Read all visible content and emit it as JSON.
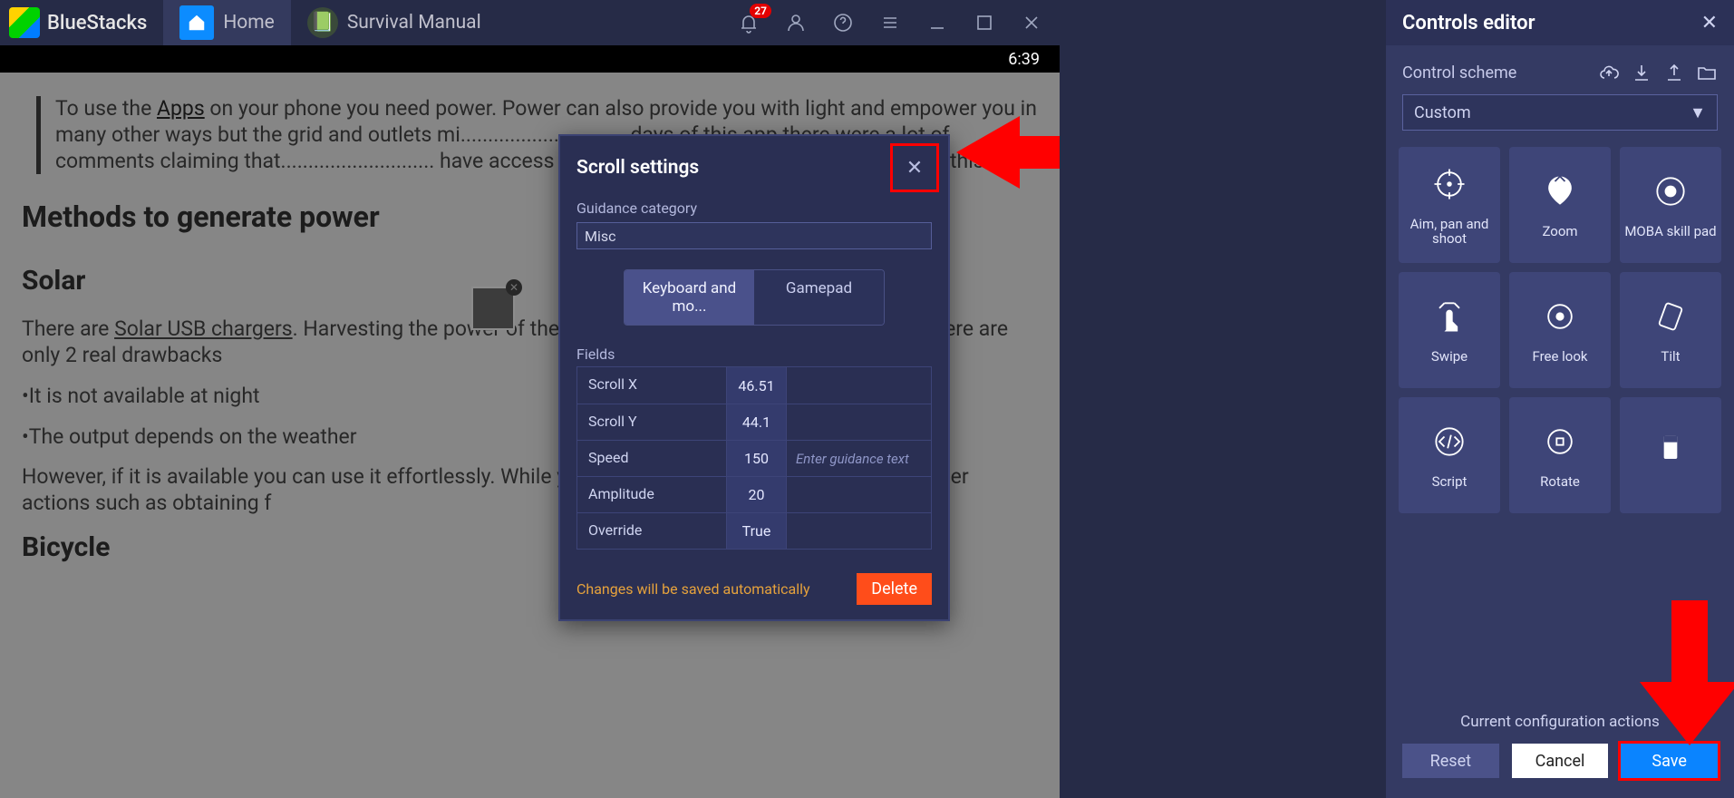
{
  "titlebar": {
    "brand": "BlueStacks",
    "tabs": [
      {
        "label": "Home"
      },
      {
        "label": "Survival Manual"
      }
    ],
    "badge": "27"
  },
  "statusbar": {
    "time": "6:39"
  },
  "content": {
    "intro_pre": "To use the ",
    "intro_link": "Apps",
    "intro_post": " on your phone you need power. Power can also provide you with light and empower you in many other ways but the grid and outlets mi.............................. days of this app there were a lot of comments claiming that............................ have access to grid power. I disagree and have created this",
    "h1": "Methods to generate power",
    "h2a": "Solar",
    "p_solar_pre": "There are ",
    "p_solar_link": "Solar USB chargers",
    "p_solar_post": ". Harvesting the power of the sur......... clean way to generate power. There are only 2 real drawbacks",
    "bullet1": "•It is not available at night",
    "bullet2": "•The output depends on the weather",
    "p_however": "However, if it is available you can use it effortlessly. While you.......... of the sun you can engage in other actions such as obtaining f",
    "h2b": "Bicycle"
  },
  "modal": {
    "title": "Scroll settings",
    "guidance_label": "Guidance category",
    "guidance_value": "Misc",
    "seg_kbm": "Keyboard and mo...",
    "seg_gamepad": "Gamepad",
    "fields_label": "Fields",
    "guidance_placeholder": "Enter guidance text",
    "rows": [
      {
        "key": "Scroll X",
        "val": "46.51",
        "guid": ""
      },
      {
        "key": "Scroll Y",
        "val": "44.1",
        "guid": ""
      },
      {
        "key": "Speed",
        "val": "150",
        "guid_ph": true
      },
      {
        "key": "Amplitude",
        "val": "20",
        "guid": ""
      },
      {
        "key": "Override",
        "val": "True",
        "guid": ""
      }
    ],
    "autosave": "Changes will be saved automatically",
    "delete": "Delete"
  },
  "sidebar": {
    "title": "Controls editor",
    "scheme_label": "Control scheme",
    "dropdown": "Custom",
    "cells": [
      "Aim, pan and shoot",
      "Zoom",
      "MOBA skill pad",
      "Swipe",
      "Free look",
      "Tilt",
      "Script",
      "Rotate",
      ""
    ],
    "conf_label": "Current configuration actions",
    "reset": "Reset",
    "cancel": "Cancel",
    "save": "Save"
  }
}
